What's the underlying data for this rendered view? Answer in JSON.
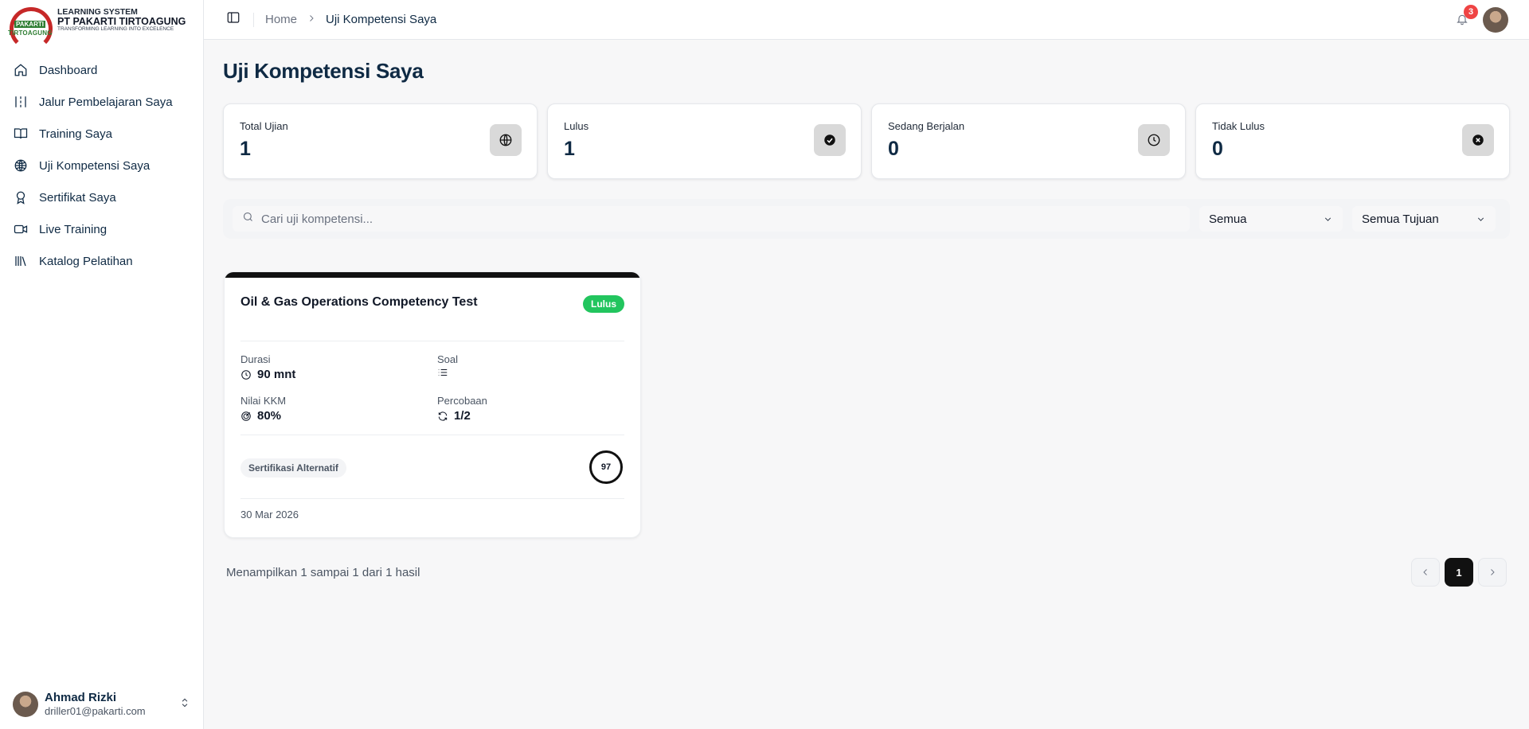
{
  "brand": {
    "line1": "LEARNING SYSTEM",
    "line2": "PT PAKARTI TIRTOAGUNG",
    "line3": "TRANSFORMING LEARNING INTO EXCELENCE",
    "logo_top": "PAKARTI",
    "logo_bottom": "TIRTOAGUNG"
  },
  "sidebar": {
    "items": [
      {
        "label": "Dashboard",
        "icon": "home-icon"
      },
      {
        "label": "Jalur Pembelajaran Saya",
        "icon": "path-icon"
      },
      {
        "label": "Training Saya",
        "icon": "book-icon"
      },
      {
        "label": "Uji Kompetensi Saya",
        "icon": "globe-icon"
      },
      {
        "label": "Sertifikat Saya",
        "icon": "award-icon"
      },
      {
        "label": "Live Training",
        "icon": "video-icon"
      },
      {
        "label": "Katalog Pelatihan",
        "icon": "library-icon"
      }
    ]
  },
  "user": {
    "name": "Ahmad Rizki",
    "email": "driller01@pakarti.com"
  },
  "header": {
    "breadcrumb_home": "Home",
    "breadcrumb_current": "Uji Kompetensi Saya",
    "notification_count": "3"
  },
  "page": {
    "title": "Uji Kompetensi Saya"
  },
  "stats": [
    {
      "label": "Total Ujian",
      "value": "1",
      "icon": "globe-icon"
    },
    {
      "label": "Lulus",
      "value": "1",
      "icon": "check-circle-icon"
    },
    {
      "label": "Sedang Berjalan",
      "value": "0",
      "icon": "clock-icon"
    },
    {
      "label": "Tidak Lulus",
      "value": "0",
      "icon": "x-circle-icon"
    }
  ],
  "filters": {
    "search_placeholder": "Cari uji kompetensi...",
    "status_value": "Semua",
    "goal_value": "Semua Tujuan"
  },
  "card": {
    "title": "Oil & Gas Operations Competency Test",
    "status": "Lulus",
    "durasi_label": "Durasi",
    "durasi_value": "90 mnt",
    "soal_label": "Soal",
    "kkm_label": "Nilai KKM",
    "kkm_value": "80%",
    "percobaan_label": "Percobaan",
    "percobaan_value": "1/2",
    "tag": "Sertifikasi Alternatif",
    "score": "97",
    "date": "30 Mar 2026"
  },
  "pagination": {
    "summary": "Menampilkan 1 sampai 1 dari 1 hasil",
    "current_page": "1"
  },
  "colors": {
    "primary_text": "#0f2a44",
    "pass_badge": "#22c55e",
    "notification": "#ef4444",
    "card_accent": "#111111"
  }
}
